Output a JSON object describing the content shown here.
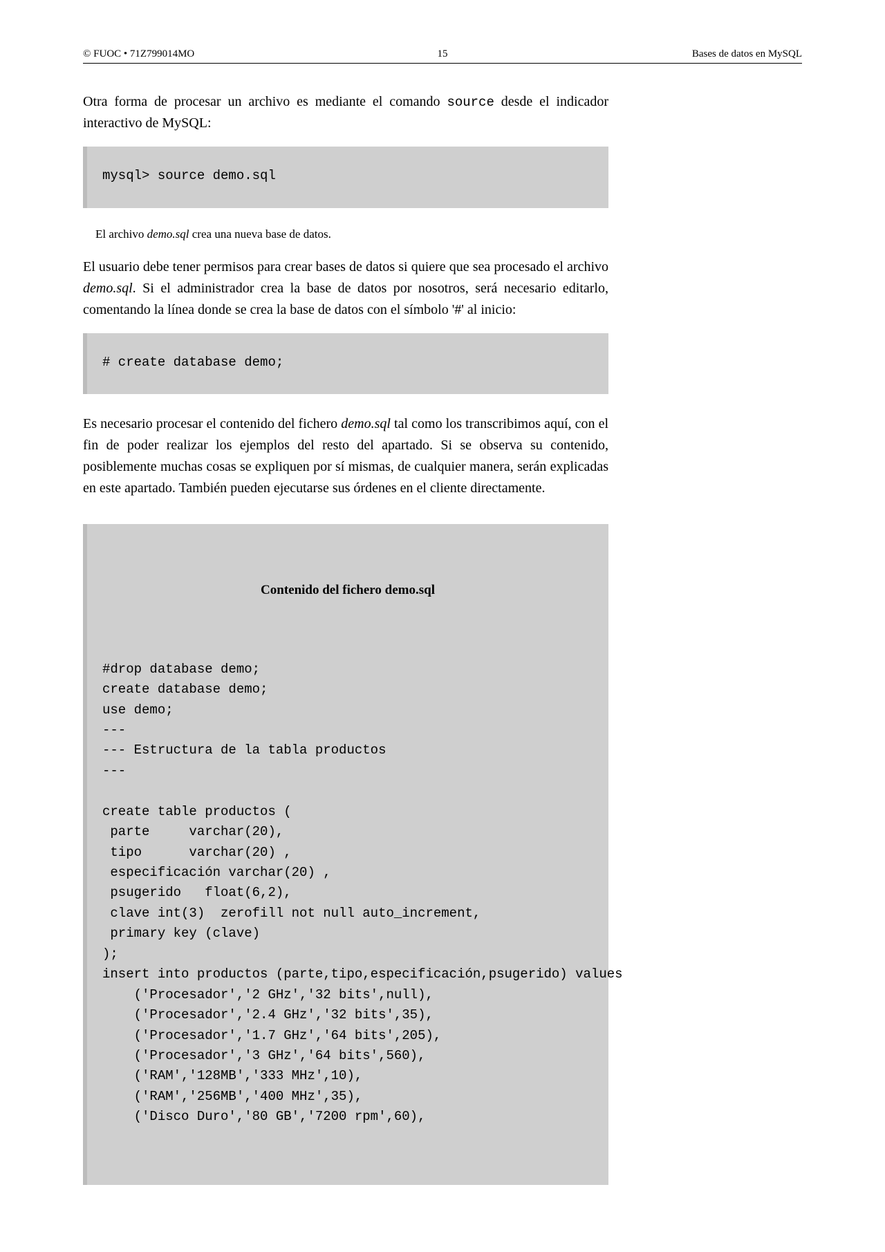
{
  "header": {
    "left": "© FUOC • 71Z799014MO",
    "center": "15",
    "right": "Bases de datos en MySQL"
  },
  "para1_pre": "Otra forma de procesar un archivo es mediante el comando ",
  "para1_code": "source",
  "para1_post": " desde el indicador interactivo de MySQL:",
  "code1": "mysql> source demo.sql",
  "caption_pre": "El archivo ",
  "caption_italic": "demo.sql",
  "caption_post": " crea una nueva base de datos.",
  "para2_a": "El usuario debe tener permisos para crear bases de datos si quiere que sea procesado el archivo ",
  "para2_b_italic": "demo.sql",
  "para2_c": ". Si el administrador crea la base de datos por nosotros, será necesario editarlo, comentando la línea donde se crea la base de datos con el símbolo '#' al inicio:",
  "code2": "# create database demo;",
  "para3_a": "Es necesario procesar el contenido del fichero ",
  "para3_b_italic": "demo.sql",
  "para3_c": " tal como los transcribimos aquí, con el fin de poder realizar los ejemplos del resto del apartado. Si se observa su contenido, posiblemente muchas cosas se expliquen por sí mismas, de cualquier manera, serán explicadas en este apartado. También pueden ejecutarse sus órdenes en el cliente directamente.",
  "code3_title": "Contenido del fichero demo.sql",
  "code3_body": "#drop database demo;\ncreate database demo;\nuse demo;\n---\n--- Estructura de la tabla productos\n---\n\ncreate table productos (\n parte     varchar(20),\n tipo      varchar(20) ,\n especificación varchar(20) ,\n psugerido   float(6,2),\n clave int(3)  zerofill not null auto_increment,\n primary key (clave)\n);\ninsert into productos (parte,tipo,especificación,psugerido) values\n    ('Procesador','2 GHz','32 bits',null),\n    ('Procesador','2.4 GHz','32 bits',35),\n    ('Procesador','1.7 GHz','64 bits',205),\n    ('Procesador','3 GHz','64 bits',560),\n    ('RAM','128MB','333 MHz',10),\n    ('RAM','256MB','400 MHz',35),\n    ('Disco Duro','80 GB','7200 rpm',60),"
}
